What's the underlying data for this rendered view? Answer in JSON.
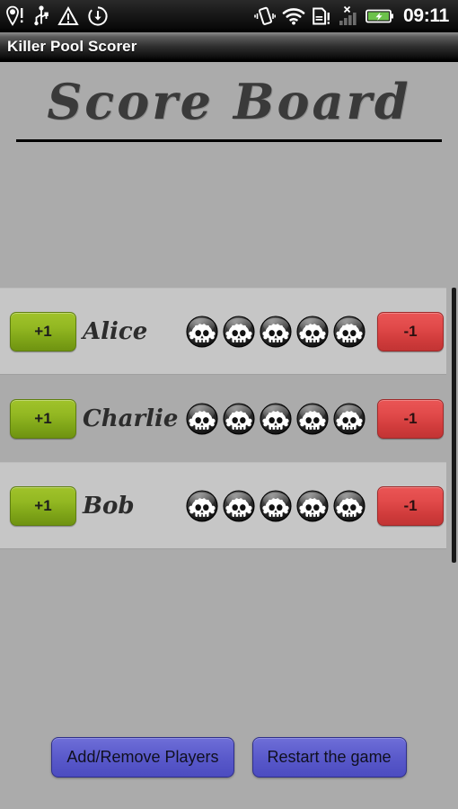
{
  "statusbar": {
    "time": "09:11",
    "left_icons": [
      {
        "name": "location-alert-icon",
        "glyph": "location-pin-exclaim"
      },
      {
        "name": "usb-icon",
        "glyph": "usb"
      },
      {
        "name": "warning-triangle-icon",
        "glyph": "warning"
      },
      {
        "name": "sync-download-icon",
        "glyph": "download-circle"
      }
    ],
    "right_icons": [
      {
        "name": "vibrate-icon",
        "glyph": "vibrate"
      },
      {
        "name": "wifi-icon",
        "glyph": "wifi"
      },
      {
        "name": "sdcard-alert-icon",
        "glyph": "sdcard-exclaim"
      },
      {
        "name": "no-signal-icon",
        "glyph": "signal-bars-x"
      },
      {
        "name": "battery-charging-icon",
        "glyph": "battery-charging"
      }
    ]
  },
  "titlebar": {
    "app_title": "Killer Pool Scorer"
  },
  "header": {
    "score_board_title": "Score Board"
  },
  "list": {
    "plus_label": "+1",
    "minus_label": "-1",
    "life_icon_name": "skull-icon",
    "players": [
      {
        "name": "Alice",
        "lives": 5,
        "striped": true
      },
      {
        "name": "Charlie",
        "lives": 5,
        "striped": false
      },
      {
        "name": "Bob",
        "lives": 5,
        "striped": true
      }
    ]
  },
  "bottom": {
    "add_remove_label": "Add/Remove Players",
    "restart_label": "Restart the game"
  },
  "colors": {
    "background": "#ababab",
    "row_stripe": "#c6c6c6",
    "plus_green": "#93b822",
    "minus_red": "#e14a4a",
    "nav_purple": "#6262d0",
    "title_text": "#3a3a3a"
  }
}
